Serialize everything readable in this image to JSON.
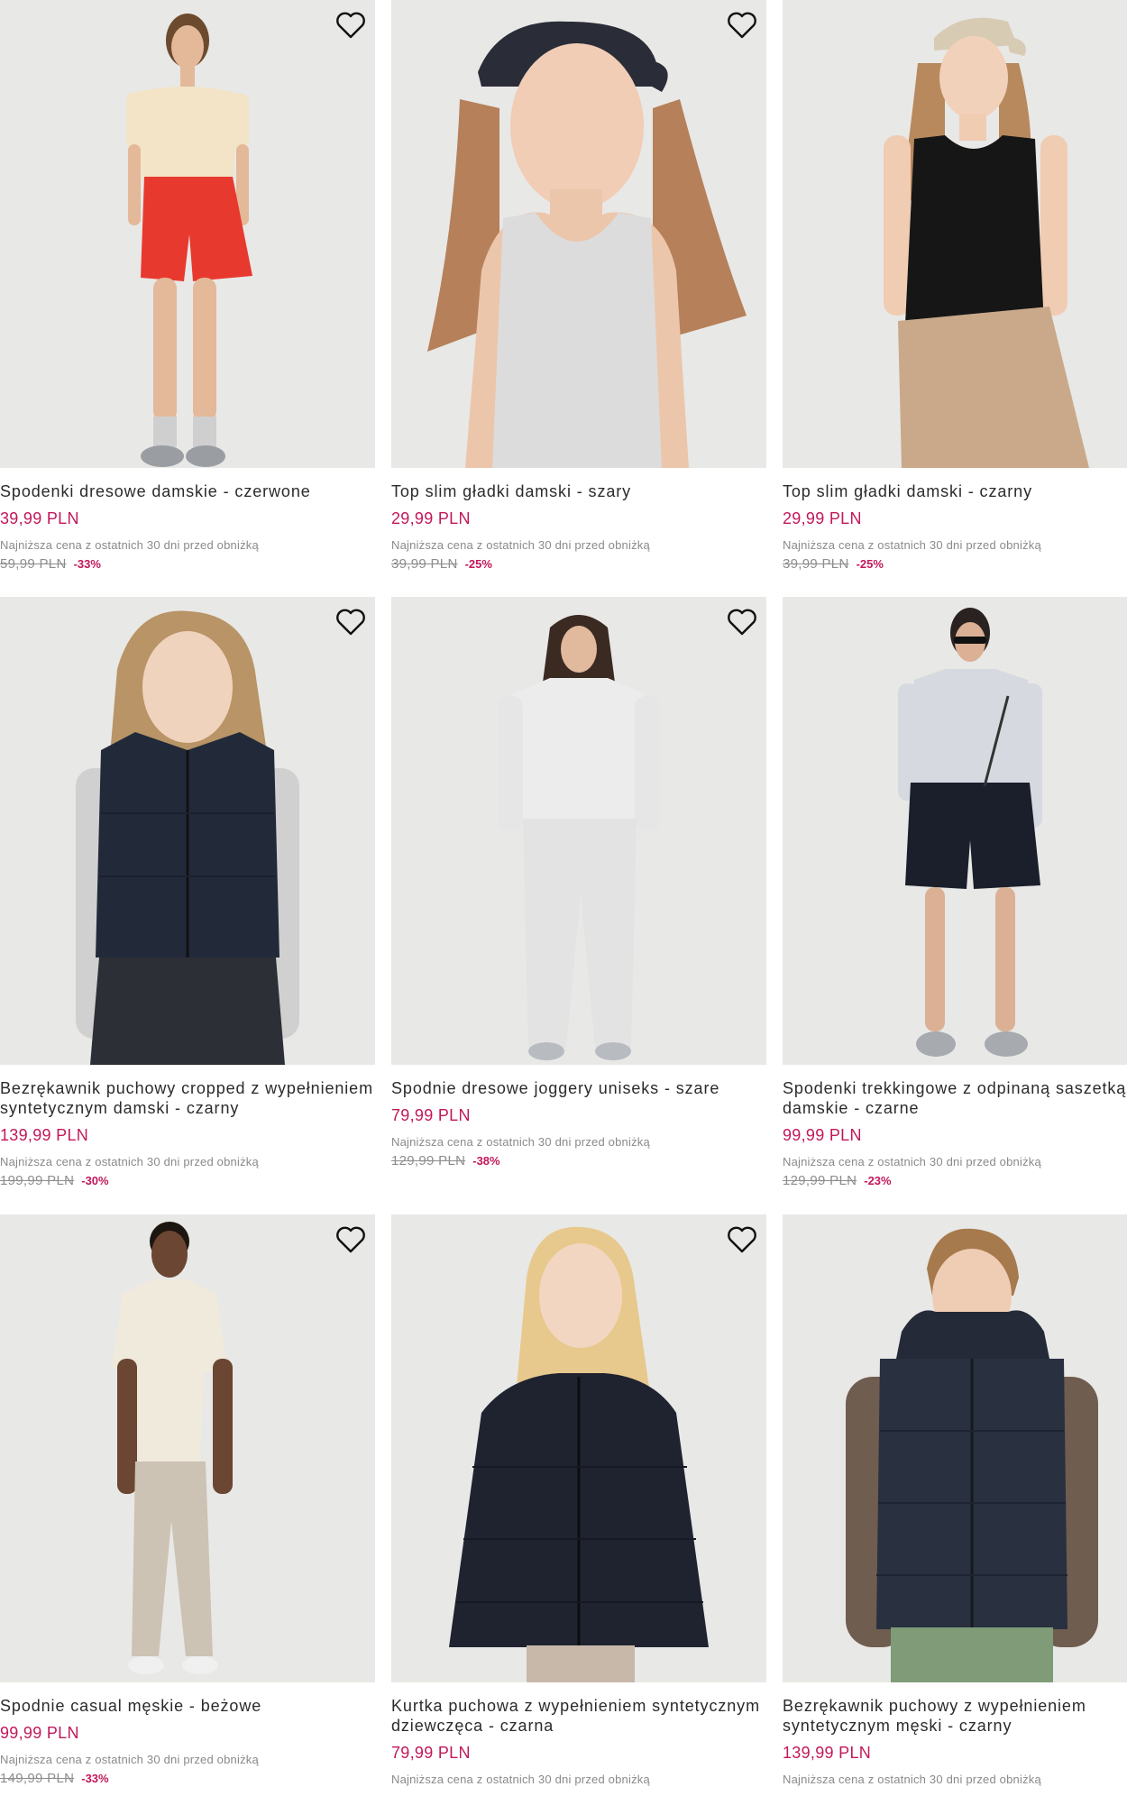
{
  "products": [
    {
      "name": "Spodenki dresowe damskie - czerwone",
      "price": "39,99 PLN",
      "lowest_note": "Najniższa cena z ostatnich 30 dni przed obniżką",
      "old_price": "59,99 PLN",
      "discount": "-33%"
    },
    {
      "name": "Top slim gładki damski - szary",
      "price": "29,99 PLN",
      "lowest_note": "Najniższa cena z ostatnich 30 dni przed obniżką",
      "old_price": "39,99 PLN",
      "discount": "-25%"
    },
    {
      "name": "Top slim gładki damski - czarny",
      "price": "29,99 PLN",
      "lowest_note": "Najniższa cena z ostatnich 30 dni przed obniżką",
      "old_price": "39,99 PLN",
      "discount": "-25%"
    },
    {
      "name": "Bezrękawnik puchowy cropped z wypełnieniem syntetycznym damski - czarny",
      "price": "139,99 PLN",
      "lowest_note": "Najniższa cena z ostatnich 30 dni przed obniżką",
      "old_price": "199,99 PLN",
      "discount": "-30%"
    },
    {
      "name": "Spodnie dresowe joggery uniseks - szare",
      "price": "79,99 PLN",
      "lowest_note": "Najniższa cena z ostatnich 30 dni przed obniżką",
      "old_price": "129,99 PLN",
      "discount": "-38%"
    },
    {
      "name": "Spodenki trekkingowe z odpinaną saszetką damskie - czarne",
      "price": "99,99 PLN",
      "lowest_note": "Najniższa cena z ostatnich 30 dni przed obniżką",
      "old_price": "129,99 PLN",
      "discount": "-23%"
    },
    {
      "name": "Spodnie casual męskie - beżowe",
      "price": "99,99 PLN",
      "lowest_note": "Najniższa cena z ostatnich 30 dni przed obniżką",
      "old_price": "149,99 PLN",
      "discount": "-33%"
    },
    {
      "name": "Kurtka puchowa z wypełnieniem syntetycznym dziewczęca - czarna",
      "price": "79,99 PLN",
      "lowest_note": "Najniższa cena z ostatnich 30 dni przed obniżką",
      "old_price": "",
      "discount": ""
    },
    {
      "name": "Bezrękawnik puchowy z wypełnieniem syntetycznym męski - czarny",
      "price": "139,99 PLN",
      "lowest_note": "Najniższa cena z ostatnich 30 dni przed obniżką",
      "old_price": "",
      "discount": ""
    }
  ],
  "icons": {
    "wishlist": "heart-outline-icon"
  },
  "colors": {
    "price": "#c2185b",
    "old_price": "#8d8d8d",
    "photo_bg": "#e8e8e6"
  }
}
